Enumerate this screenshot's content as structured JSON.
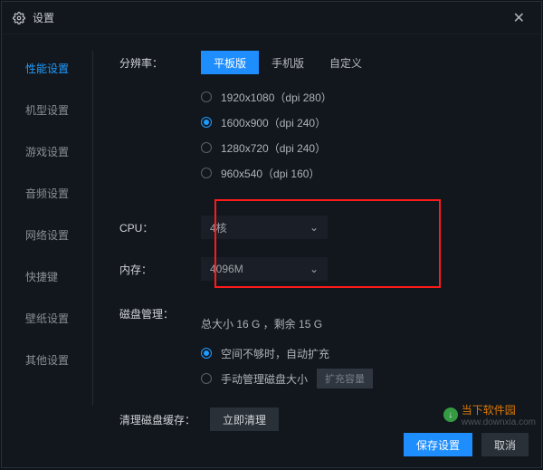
{
  "window": {
    "title": "设置"
  },
  "sidebar": {
    "items": [
      {
        "label": "性能设置"
      },
      {
        "label": "机型设置"
      },
      {
        "label": "游戏设置"
      },
      {
        "label": "音频设置"
      },
      {
        "label": "网络设置"
      },
      {
        "label": "快捷键"
      },
      {
        "label": "壁纸设置"
      },
      {
        "label": "其他设置"
      }
    ]
  },
  "resolution": {
    "label": "分辨率：",
    "tabs": [
      {
        "label": "平板版"
      },
      {
        "label": "手机版"
      },
      {
        "label": "自定义"
      }
    ],
    "options": [
      {
        "label": "1920x1080（dpi 280）"
      },
      {
        "label": "1600x900（dpi 240）"
      },
      {
        "label": "1280x720（dpi 240）"
      },
      {
        "label": "960x540（dpi 160）"
      }
    ]
  },
  "cpu": {
    "label": "CPU：",
    "value": "4核"
  },
  "memory": {
    "label": "内存：",
    "value": "4096M"
  },
  "disk": {
    "label": "磁盘管理：",
    "info": "总大小 16 G ，剩余 15 G",
    "mode_auto": "空间不够时，自动扩充",
    "mode_manual": "手动管理磁盘大小",
    "expand_btn": "扩充容量"
  },
  "cache": {
    "label": "清理磁盘缓存：",
    "btn": "立即清理"
  },
  "footer": {
    "save": "保存设置",
    "cancel": "取消"
  },
  "watermark": {
    "name": "当下软件园",
    "url": "www.downxia.com"
  }
}
